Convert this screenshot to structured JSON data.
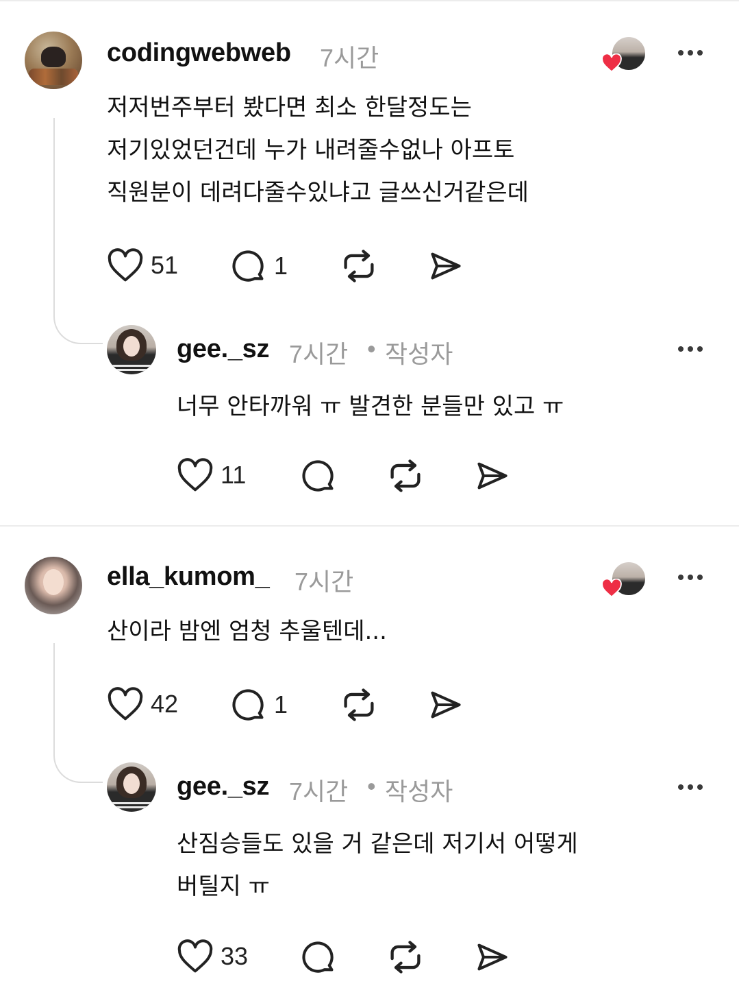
{
  "comments": [
    {
      "username": "codingwebweb",
      "time": "7시간",
      "body": "저저번주부터 봤다면 최소 한달정도는\n저기있었던건데 누가 내려줄수없나 아프토\n직원분이 데려다줄수있냐고 글쓰신거같은데",
      "likes": "51",
      "replies": "1",
      "reply": {
        "username": "gee._sz",
        "time": "7시간",
        "separator": "•",
        "author_badge": "작성자",
        "body": "너무 안타까워 ㅠ 발견한 분들만 있고 ㅠ",
        "likes": "11"
      }
    },
    {
      "username": "ella_kumom_",
      "time": "7시간",
      "body": "산이라 밤엔 엄청 추울텐데...",
      "likes": "42",
      "replies": "1",
      "reply": {
        "username": "gee._sz",
        "time": "7시간",
        "separator": "•",
        "author_badge": "작성자",
        "body": "산짐승들도 있을 거 같은데 저기서 어떻게\n버틸지 ㅠ",
        "likes": "33"
      }
    }
  ],
  "icons": {
    "like": "heart-outline-icon",
    "reply": "speech-bubble-icon",
    "repost": "repost-icon",
    "share": "send-icon",
    "more": "more-dots-icon",
    "liked_by_author": "heart-filled-icon"
  },
  "colors": {
    "liked_heart": "#ee2e45",
    "meta_gray": "#9a9a9a",
    "divider": "#ececec"
  }
}
